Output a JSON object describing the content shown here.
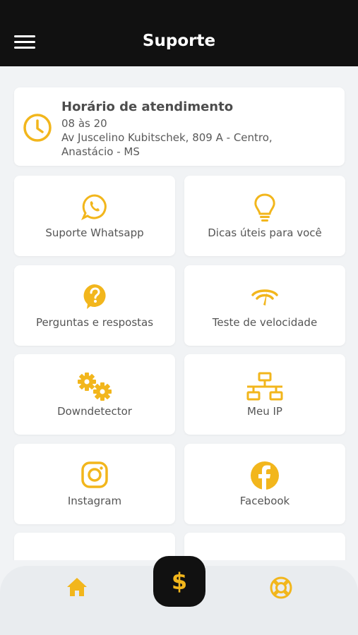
{
  "header": {
    "title": "Suporte",
    "menu_icon": "hamburger-menu-icon"
  },
  "info_card": {
    "title": "Horário de atendimento",
    "hours": "08 às 20",
    "address_line1": "Av Juscelino Kubitschek, 809 A - Centro,",
    "address_line2": "Anastácio - MS",
    "icon": "clock-icon"
  },
  "tiles": [
    {
      "label": "Suporte Whatsapp",
      "icon": "whatsapp-icon"
    },
    {
      "label": "Dicas úteis para você",
      "icon": "lightbulb-icon"
    },
    {
      "label": "Perguntas e respostas",
      "icon": "question-icon"
    },
    {
      "label": "Teste de velocidade",
      "icon": "speedometer-icon"
    },
    {
      "label": "Downdetector",
      "icon": "gears-icon"
    },
    {
      "label": "Meu IP",
      "icon": "network-icon"
    },
    {
      "label": "Instagram",
      "icon": "instagram-icon"
    },
    {
      "label": "Facebook",
      "icon": "facebook-icon"
    }
  ],
  "bottom_nav": {
    "home_icon": "home-icon",
    "center_label": "$",
    "support_icon": "lifebuoy-icon"
  },
  "colors": {
    "accent": "#f2b61c",
    "header_bg": "#111111",
    "background": "#f1f3f5"
  }
}
